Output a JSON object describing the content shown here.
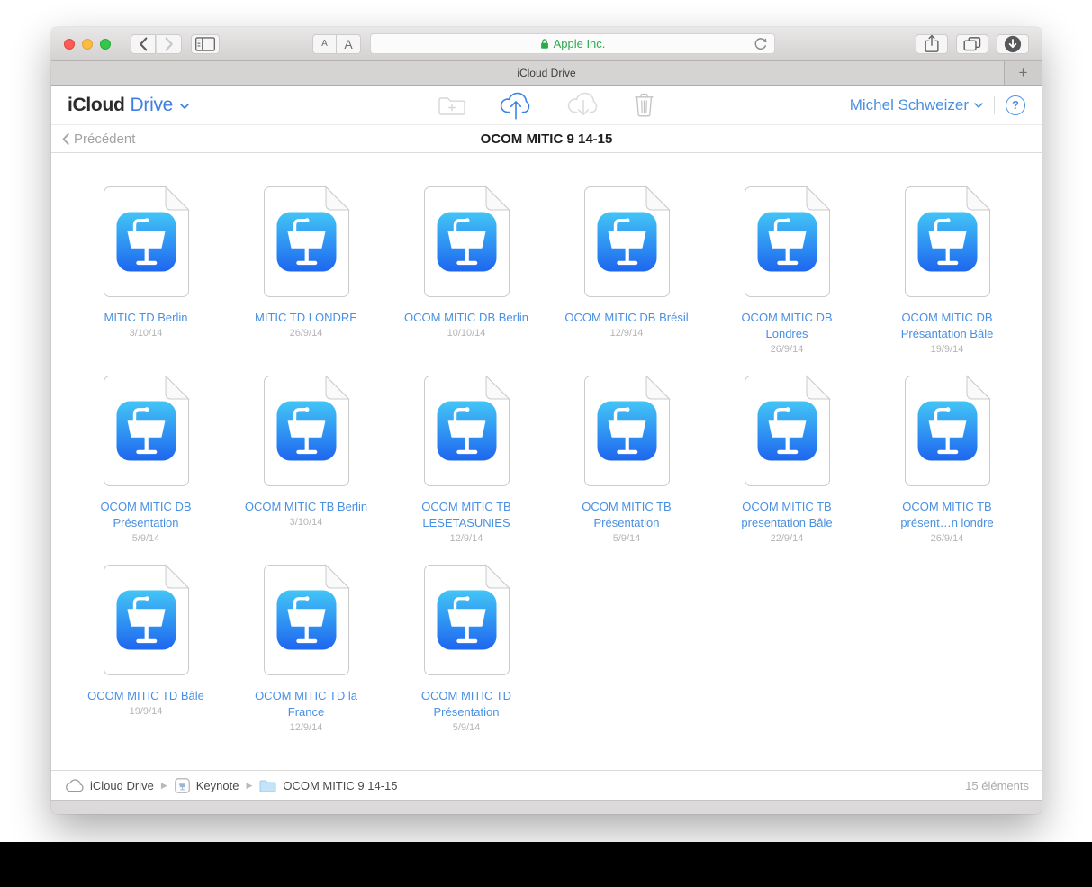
{
  "browser": {
    "font_smaller": "A",
    "font_larger": "A",
    "address": {
      "site_name": "Apple Inc."
    },
    "tab_title": "iCloud Drive",
    "new_tab_label": "+"
  },
  "app_header": {
    "brand": "iCloud",
    "section": "Drive",
    "user_name": "Michel Schweizer",
    "help_label": "?"
  },
  "nav_bar": {
    "back_label": "Précédent",
    "folder_title": "OCOM MITIC 9 14-15"
  },
  "files": [
    {
      "name": "MITIC TD Berlin",
      "date": "3/10/14"
    },
    {
      "name": "MITIC TD LONDRE",
      "date": "26/9/14"
    },
    {
      "name": "OCOM MITIC DB Berlin",
      "date": "10/10/14"
    },
    {
      "name": "OCOM MITIC DB Brésil",
      "date": "12/9/14"
    },
    {
      "name": "OCOM MITIC DB Londres",
      "date": "26/9/14"
    },
    {
      "name": "OCOM MITIC DB Présantation Bâle",
      "date": "19/9/14"
    },
    {
      "name": "OCOM MITIC DB Présentation",
      "date": "5/9/14"
    },
    {
      "name": "OCOM MITIC TB Berlin",
      "date": "3/10/14"
    },
    {
      "name": "OCOM MITIC TB LESETASUNIES",
      "date": "12/9/14"
    },
    {
      "name": "OCOM MITIC TB Présentation",
      "date": "5/9/14"
    },
    {
      "name": "OCOM MITIC TB presentation Bâle",
      "date": "22/9/14"
    },
    {
      "name": "OCOM MITIC TB présent…n londre",
      "date": "26/9/14"
    },
    {
      "name": "OCOM MITIC TD Bâle",
      "date": "19/9/14"
    },
    {
      "name": "OCOM MITIC TD la France",
      "date": "12/9/14"
    },
    {
      "name": "OCOM MITIC TD Présentation",
      "date": "5/9/14"
    }
  ],
  "footer": {
    "breadcrumbs": [
      {
        "label": "iCloud Drive"
      },
      {
        "label": "Keynote"
      },
      {
        "label": "OCOM MITIC 9 14-15"
      }
    ],
    "item_count": "15 éléments"
  },
  "colors": {
    "link_blue": "#4a90e2",
    "upload_blue": "#3b82e8",
    "secure_green": "#27ab4b",
    "keynote_gradient_top": "#43c5f6",
    "keynote_gradient_bottom": "#1e66ef"
  }
}
